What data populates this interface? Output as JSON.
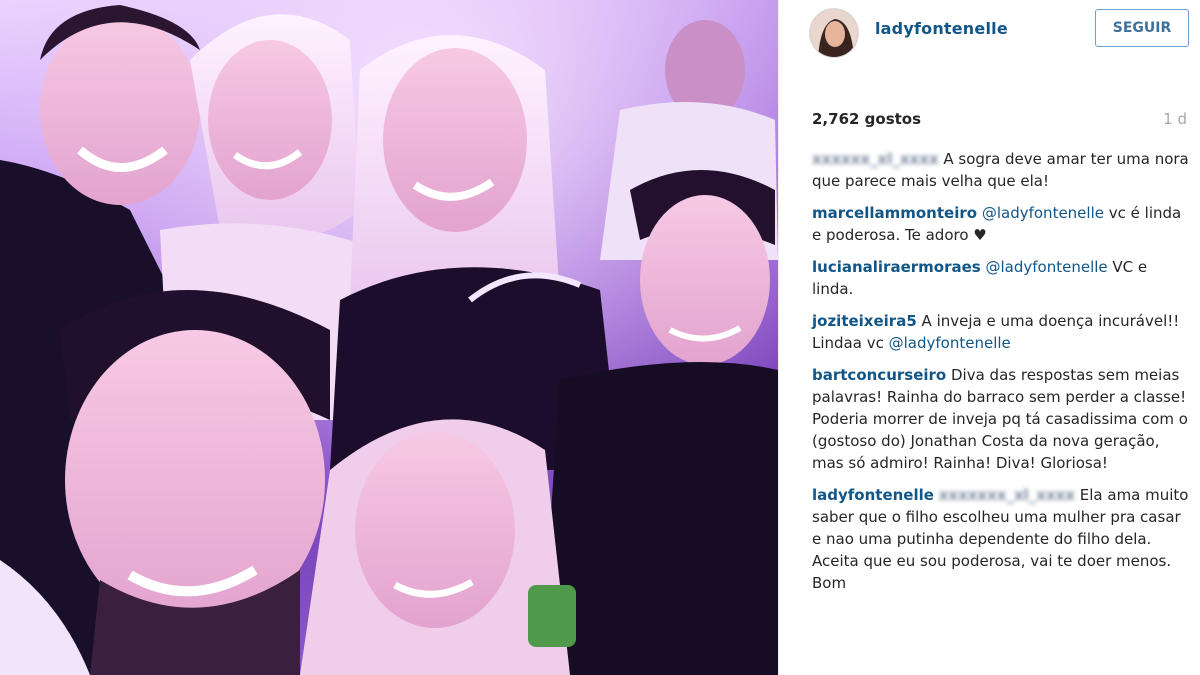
{
  "post": {
    "username": "ladyfontenelle",
    "follow_label": "SEGUIR",
    "likes": "2,762 gostos",
    "time_ago": "1 d"
  },
  "comments": [
    {
      "user": "",
      "text": "A sogra deve amar ter uma nora que parece mais velha que ela!"
    },
    {
      "user": "marcellammonteiro",
      "mention": "@ladyfontenelle",
      "text": "vc é linda e poderosa. Te adoro ♥"
    },
    {
      "user": "lucianaliraermoraes",
      "mention": "@ladyfontenelle",
      "text": "VC e linda."
    },
    {
      "user": "joziteixeira5",
      "text": "A inveja e uma doença incurável!! Lindaa vc",
      "mention": "@ladyfontenelle"
    },
    {
      "user": "bartconcurseiro",
      "text": "Diva das respostas sem meias palavras! Rainha do barraco sem perder a classe! Poderia morrer de inveja pq tá casadissima com o (gostoso do) Jonathan Costa da nova geração, mas só admiro! Rainha! Diva! Gloriosa!"
    },
    {
      "user": "ladyfontenelle",
      "text": "Ela ama muito saber que o filho escolheu uma mulher pra casar e nao uma putinha dependente do filho dela. Aceita que eu sou poderosa, vai te doer menos. Bom"
    }
  ],
  "colors": {
    "link": "#125688",
    "follow_border": "#6fa1cf",
    "muted": "#a5a7aa"
  }
}
